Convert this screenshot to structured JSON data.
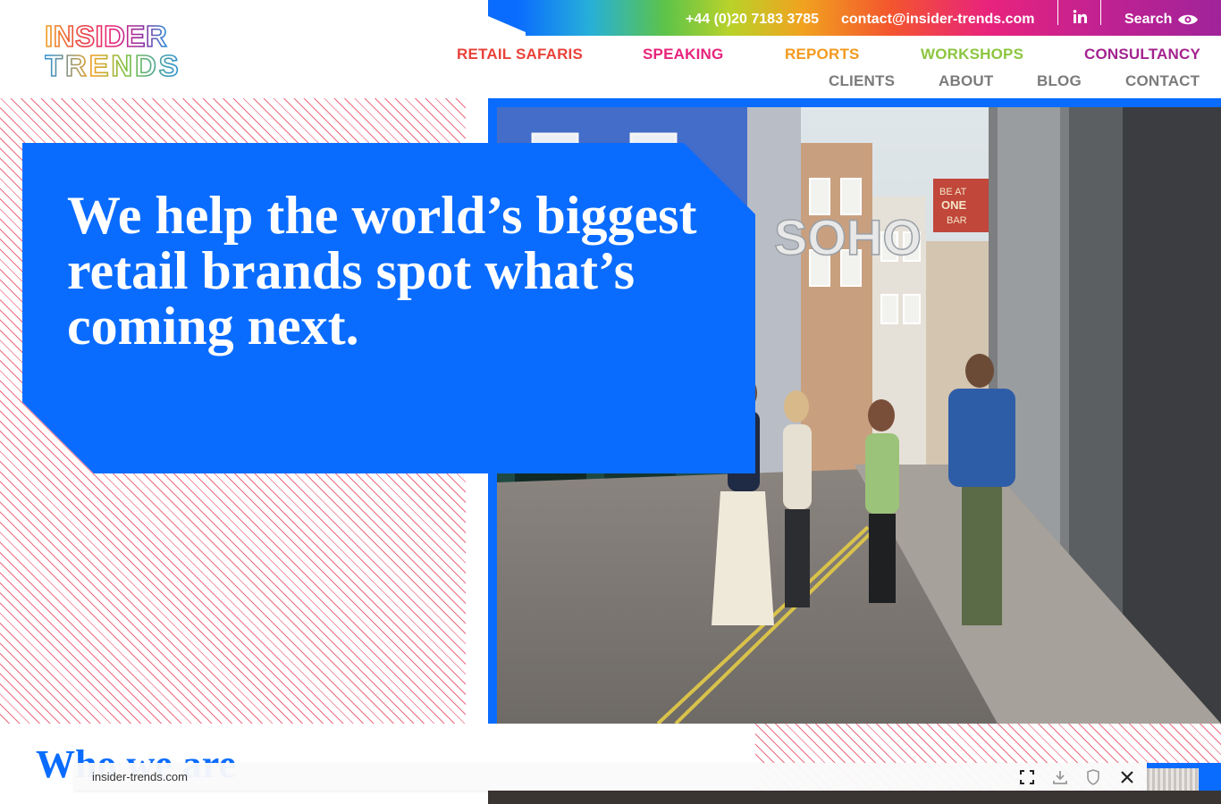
{
  "header": {
    "logo_text_line1": "INSIDER",
    "logo_text_line2": "TRENDS",
    "phone": "+44 (0)20 7183 3785",
    "email": "contact@insider-trends.com",
    "search_label": "Search",
    "linkedin_icon": "linkedin-icon",
    "search_icon": "eye-icon"
  },
  "nav": {
    "primary": [
      {
        "label": "RETAIL SAFARIS",
        "color": "#e8423a"
      },
      {
        "label": "SPEAKING",
        "color": "#e8237c"
      },
      {
        "label": "REPORTS",
        "color": "#f29a1f"
      },
      {
        "label": "WORKSHOPS",
        "color": "#8cc63f"
      },
      {
        "label": "CONSULTANCY",
        "color": "#a3238f"
      }
    ],
    "secondary": [
      {
        "label": "CLIENTS"
      },
      {
        "label": "ABOUT"
      },
      {
        "label": "BLOG"
      },
      {
        "label": "CONTACT"
      }
    ]
  },
  "hero": {
    "title": "We help the world’s biggest retail brands spot what’s coming next.",
    "photo_sign_soho": "SOHO",
    "photo_sign_bar_1": "BE AT",
    "photo_sign_bar_2": "ONE",
    "photo_sign_bar_3": "BAR",
    "accent_color": "#0a6cff"
  },
  "section": {
    "title": "Who we are"
  },
  "browser_overlay": {
    "url": "insider-trends.com",
    "icons": [
      "fullscreen-icon",
      "download-icon",
      "shield-icon",
      "close-icon"
    ]
  }
}
